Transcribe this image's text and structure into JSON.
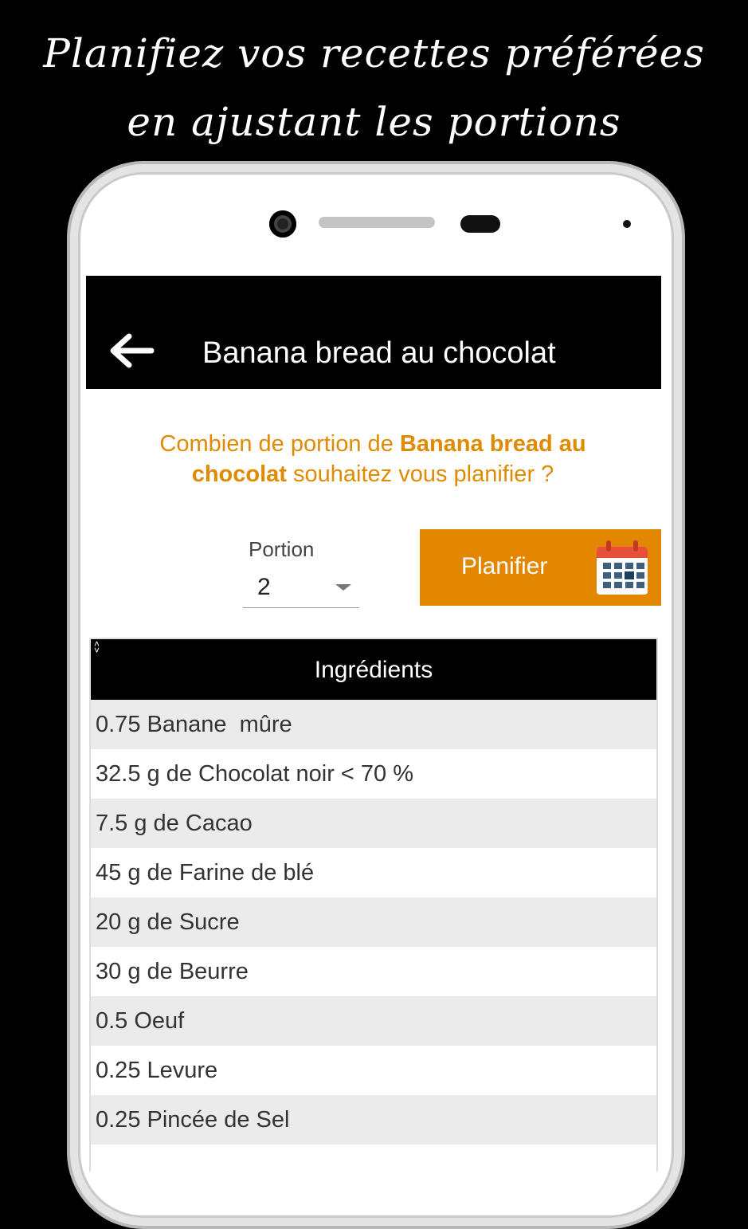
{
  "promo": {
    "line1": "Planifiez vos recettes préférées",
    "line2": "en ajustant les portions"
  },
  "appbar": {
    "back_icon": "arrow-left-icon",
    "title": "Banana bread au chocolat"
  },
  "question": {
    "prefix": "Combien de portion de ",
    "recipe": "Banana bread au chocolat",
    "suffix": " souhaitez vous planifier ?"
  },
  "portion": {
    "label": "Portion",
    "value": "2"
  },
  "plan_button": {
    "label": "Planifier",
    "icon": "calendar-icon",
    "color": "#e38600"
  },
  "ingredients": {
    "header": "Ingrédients",
    "items": [
      "0.75 Banane  mûre",
      "32.5 g de Chocolat noir < 70 %",
      "7.5 g de Cacao",
      "45 g de Farine de blé",
      "20 g de Sucre",
      "30 g de Beurre",
      "0.5 Oeuf",
      "0.25 Levure",
      "0.25 Pincée de Sel"
    ]
  },
  "colors": {
    "accent": "#e08a00",
    "bar": "#000000",
    "row_alt": "#ebebeb"
  }
}
